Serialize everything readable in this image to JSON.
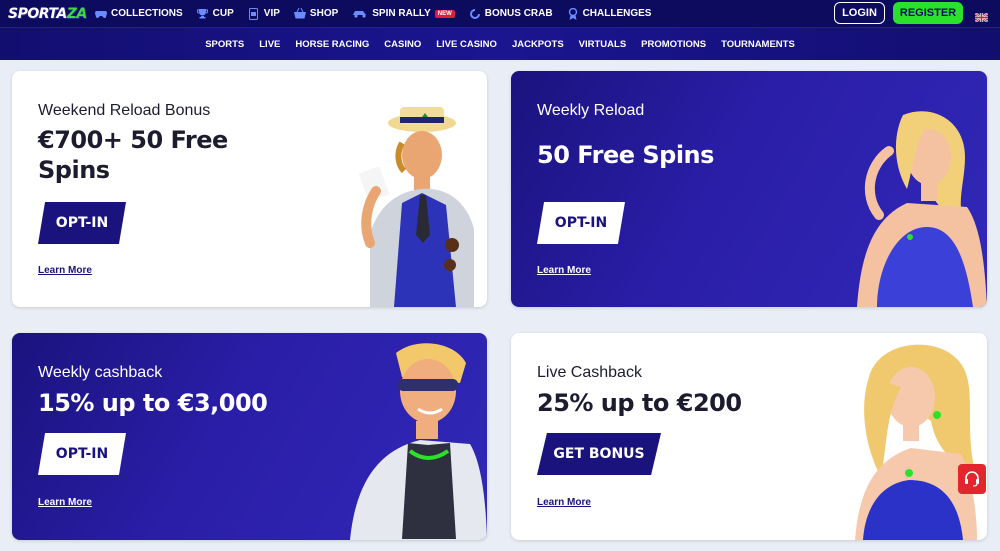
{
  "header": {
    "logo": {
      "main": "SPORTA",
      "accent": "ZA"
    },
    "nav": [
      {
        "label": "COLLECTIONS",
        "icon": "controller-icon"
      },
      {
        "label": "CUP",
        "icon": "trophy-icon"
      },
      {
        "label": "VIP",
        "icon": "vip-card-icon"
      },
      {
        "label": "SHOP",
        "icon": "basket-icon"
      },
      {
        "label": "SPIN RALLY",
        "icon": "rally-car-icon",
        "badge": "NEW"
      },
      {
        "label": "BONUS CRAB",
        "icon": "crab-icon"
      },
      {
        "label": "CHALLENGES",
        "icon": "medal-icon"
      }
    ],
    "login": "LOGIN",
    "register": "REGISTER",
    "language_flag": "uk-flag-icon"
  },
  "subnav": [
    "SPORTS",
    "LIVE",
    "HORSE RACING",
    "CASINO",
    "LIVE CASINO",
    "JACKPOTS",
    "VIRTUALS",
    "PROMOTIONS",
    "TOURNAMENTS"
  ],
  "promotions": [
    {
      "title": "Weekend Reload Bonus",
      "headline_line1": "€700+ 50 Free",
      "headline_line2": "Spins",
      "button": "OPT-IN",
      "link": "Learn More",
      "theme": "white"
    },
    {
      "title": "Weekly Reload",
      "headline_line1": "50 Free Spins",
      "button": "OPT-IN",
      "link": "Learn More",
      "theme": "blue"
    },
    {
      "title": "Weekly cashback",
      "headline_line1": "15% up to €3,000",
      "button": "OPT-IN",
      "link": "Learn More",
      "theme": "blue"
    },
    {
      "title": "Live Cashback",
      "headline_line1": "25% up to €200",
      "button": "GET BONUS",
      "link": "Learn More",
      "theme": "white"
    }
  ],
  "colors": {
    "navy": "#0d0b5e",
    "brand_blue": "#1a137e",
    "green": "#2be12b",
    "red": "#e3262e"
  }
}
